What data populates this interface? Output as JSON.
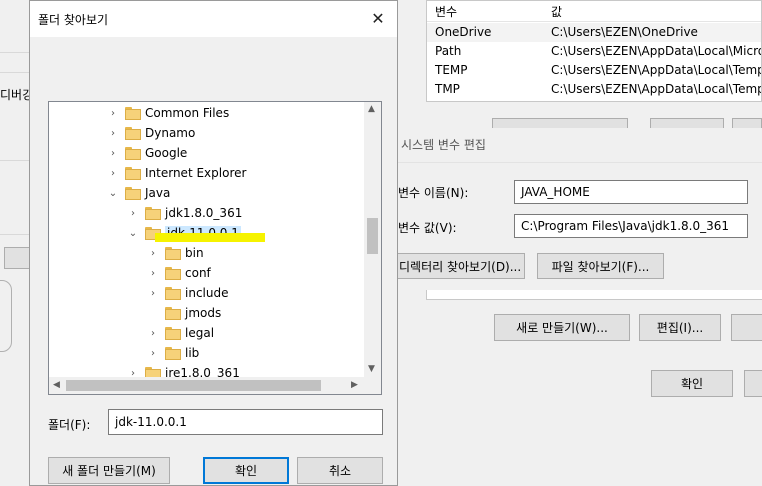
{
  "background_left": {
    "partial_label": "디버깅"
  },
  "env_vars": {
    "col_variable": "변수",
    "col_value": "값",
    "rows": [
      {
        "name": "OneDrive",
        "value": "C:\\Users\\EZEN\\OneDrive"
      },
      {
        "name": "Path",
        "value": "C:\\Users\\EZEN\\AppData\\Local\\Micro"
      },
      {
        "name": "TEMP",
        "value": "C:\\Users\\EZEN\\AppData\\Local\\Temp"
      },
      {
        "name": "TMP",
        "value": "C:\\Users\\EZEN\\AppData\\Local\\Temp"
      }
    ]
  },
  "sys_dialog": {
    "title": "시스템 변수 편집",
    "name_label": "변수 이름(N):",
    "name_value": "JAVA_HOME",
    "value_label": "변수 값(V):",
    "value_value": "C:\\Program Files\\Java\\jdk1.8.0_361",
    "browse_dir_button": "디렉터리 찾아보기(D)...",
    "browse_file_button": "파일 찾아보기(F)...",
    "new_button": "새로 만들기(W)...",
    "edit_button": "편집(I)...",
    "ok_button": "확인"
  },
  "folder_dialog": {
    "title": "폴더 찾아보기",
    "close_glyph": "✕",
    "folder_label": "폴더(F):",
    "folder_value": "jdk-11.0.0.1",
    "new_folder_button": "새 폴더 만들기(M)",
    "ok_button": "확인",
    "cancel_button": "취소",
    "tree": [
      {
        "label": "Common Files",
        "depth": 0,
        "expander": "›"
      },
      {
        "label": "Dynamo",
        "depth": 0,
        "expander": "›"
      },
      {
        "label": "Google",
        "depth": 0,
        "expander": "›"
      },
      {
        "label": "Internet Explorer",
        "depth": 0,
        "expander": "›"
      },
      {
        "label": "Java",
        "depth": 0,
        "expander": "⌄"
      },
      {
        "label": "jdk1.8.0_361",
        "depth": 1,
        "expander": "›"
      },
      {
        "label": "jdk-11.0.0.1",
        "depth": 1,
        "expander": "⌄",
        "selected": true
      },
      {
        "label": "bin",
        "depth": 2,
        "expander": "›"
      },
      {
        "label": "conf",
        "depth": 2,
        "expander": "›"
      },
      {
        "label": "include",
        "depth": 2,
        "expander": "›"
      },
      {
        "label": "jmods",
        "depth": 2,
        "expander": ""
      },
      {
        "label": "legal",
        "depth": 2,
        "expander": "›"
      },
      {
        "label": "lib",
        "depth": 2,
        "expander": "›"
      },
      {
        "label": "jre1.8.0_361",
        "depth": 1,
        "expander": "›"
      }
    ]
  }
}
